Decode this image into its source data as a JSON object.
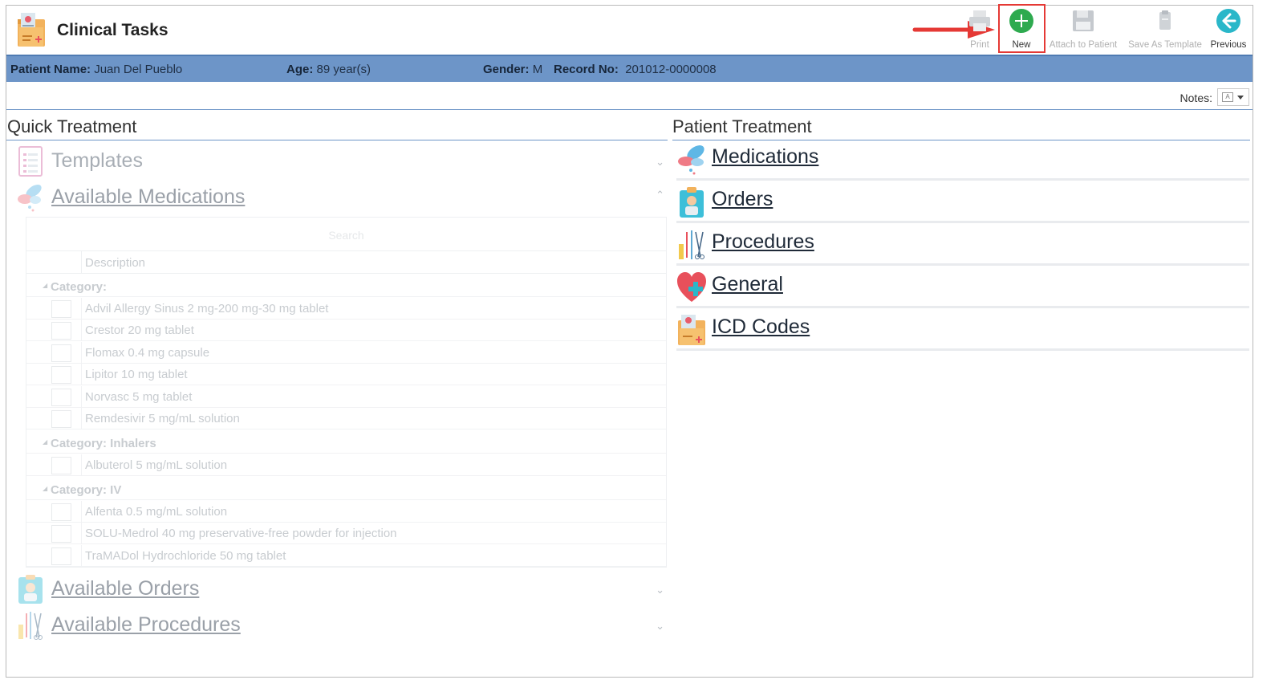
{
  "app": {
    "title": "Clinical Tasks",
    "icon": "clinical-folder-icon"
  },
  "toolbar": {
    "print": "Print",
    "new": "New",
    "attach": "Attach to Patient",
    "save_template": "Save As Template",
    "previous": "Previous"
  },
  "patient": {
    "name_label": "Patient Name:",
    "name": "Juan Del Pueblo",
    "age_label": "Age:",
    "age": "89 year(s)",
    "gender_label": "Gender:",
    "gender": "M",
    "record_label": "Record No:",
    "record": "201012-0000008"
  },
  "notes": {
    "label": "Notes:"
  },
  "quick_treatment": {
    "title": "Quick Treatment",
    "templates": "Templates",
    "available_medications": "Available Medications",
    "available_orders": "Available Orders",
    "available_procedures": "Available Procedures",
    "grid": {
      "search_placeholder": "Search",
      "column_description": "Description",
      "categories": [
        {
          "label": "Category:",
          "items": [
            "Advil Allergy Sinus 2 mg-200 mg-30 mg tablet",
            "Crestor 20 mg tablet",
            "Flomax 0.4 mg capsule",
            "Lipitor 10 mg tablet",
            "Norvasc 5 mg tablet",
            "Remdesivir 5 mg/mL solution"
          ]
        },
        {
          "label": "Category: Inhalers",
          "items": [
            "Albuterol 5 mg/mL solution"
          ]
        },
        {
          "label": "Category: IV",
          "items": [
            "Alfenta 0.5 mg/mL solution",
            "SOLU-Medrol 40 mg preservative-free powder for injection",
            "TraMADol Hydrochloride 50 mg tablet"
          ]
        }
      ]
    }
  },
  "patient_treatment": {
    "title": "Patient Treatment",
    "items": [
      "Medications",
      "Orders",
      "Procedures",
      "General",
      "ICD Codes"
    ]
  },
  "colors": {
    "patient_bar": "#6d95c8",
    "new_button": "#2eaa4f",
    "previous_button": "#2ab7c9",
    "highlight": "#e53935"
  }
}
